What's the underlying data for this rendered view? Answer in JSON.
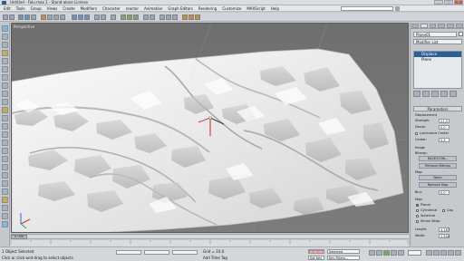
{
  "window": {
    "title": "Untitled - Falu.max 1 - Stand-alone License"
  },
  "menubar": {
    "items": [
      "Edit",
      "Tools",
      "Group",
      "Views",
      "Create",
      "Modifiers",
      "Character",
      "reactor",
      "Animation",
      "Graph Editors",
      "Rendering",
      "Customize",
      "MAXScript",
      "Help"
    ]
  },
  "viewport": {
    "label": "Perspective"
  },
  "command_panel": {
    "object_name": "Plane01",
    "modifier_list": "Modifier List",
    "stack": [
      "Displace",
      "Plane"
    ],
    "rollout_title": "Parameters",
    "displacement_label": "Displacement",
    "strength_label": "Strength:",
    "strength_value": "21.0",
    "decay_label": "Decay:",
    "decay_value": "0.0",
    "luminance_center_label": "Luminance Center",
    "center_label": "Center:",
    "center_value": "0.5",
    "image_label": "Image",
    "bitmap_label": "Bitmap:",
    "bitmap_value": "N42E013W...",
    "remove_bitmap_label": "Remove Bitmap",
    "map_label": "Map:",
    "none_label": "None",
    "remove_map_label": "Remove Map",
    "blur_label": "Blur:",
    "blur_value": "0.0",
    "map_section_label": "Map:",
    "mapping_options": [
      "Planar",
      "Cylindrical",
      "Cap",
      "Spherical",
      "Shrink Wrap"
    ],
    "length_label": "Length:",
    "length_value": "4.167",
    "width_label": "Width:",
    "width_value": "2.500"
  },
  "timeline": {
    "frame": "0 / 100"
  },
  "statusbar": {
    "selected": "1 Object Selected",
    "prompt": "Click or click-and-drag to select objects",
    "grid": "Grid = 10.0",
    "add_time_tag": "Add Time Tag",
    "auto_key": "Auto Key",
    "selected_mode": "Selected",
    "set_key": "Set Key",
    "key_filters": "Key Filters..."
  }
}
